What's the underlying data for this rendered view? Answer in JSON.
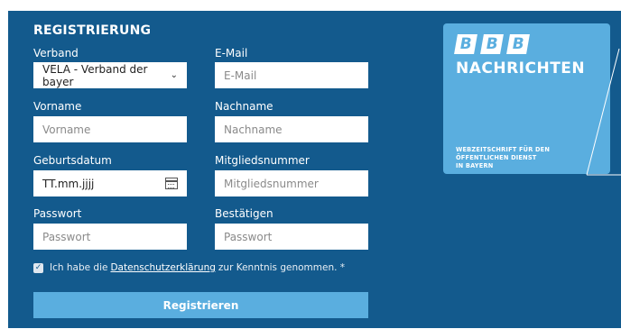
{
  "form": {
    "title": "REGISTRIERUNG",
    "labels": {
      "verband": "Verband",
      "email": "E-Mail",
      "vorname": "Vorname",
      "nachname": "Nachname",
      "geburtsdatum": "Geburtsdatum",
      "mitgliedsnummer": "Mitgliedsnummer",
      "passwort": "Passwort",
      "bestaetigen": "Bestätigen"
    },
    "verband_value": "VELA - Verband der bayer",
    "placeholders": {
      "email": "E-Mail",
      "vorname": "Vorname",
      "nachname": "Nachname",
      "mitgliedsnummer": "Mitgliedsnummer",
      "passwort": "Passwort",
      "bestaetigen": "Passwort"
    },
    "geburtsdatum_value": "TT.mm.jjjj",
    "consent": {
      "checked": true,
      "text_before": "Ich habe die",
      "link": "Datenschutzerklärung",
      "text_after": "zur Kenntnis genommen. *"
    },
    "submit_label": "Registrieren"
  },
  "logo": {
    "letters": [
      "B",
      "B",
      "B"
    ],
    "name": "NACHRICHTEN",
    "tagline_1": "WEBZEITSCHRIFT FÜR DEN",
    "tagline_2": "ÖFFENTLICHEN DIENST",
    "tagline_3": "IN BAYERN"
  },
  "colors": {
    "panel": "#135a8d",
    "accent": "#5aaedf",
    "field": "#ffffff"
  },
  "icons": {
    "select_arrow": "chevron-down-icon",
    "date_picker": "calendar-icon",
    "consent_check": "checkmark-icon"
  }
}
